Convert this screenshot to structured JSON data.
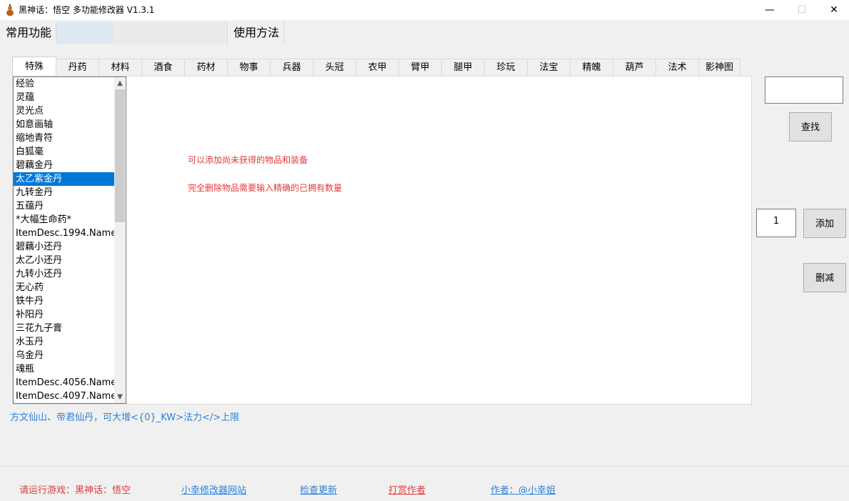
{
  "window": {
    "title": "黑神话：悟空 多功能修改器 V1.3.1",
    "minimize": "—",
    "maximize": "☐",
    "close": "✕"
  },
  "main_tabs": [
    "常用功能",
    "使用方法"
  ],
  "sub_tabs": [
    "特殊",
    "丹药",
    "材料",
    "酒食",
    "药材",
    "物事",
    "兵器",
    "头冠",
    "衣甲",
    "臂甲",
    "腿甲",
    "珍玩",
    "法宝",
    "精魄",
    "葫芦",
    "法术",
    "影神图"
  ],
  "item_list": {
    "items": [
      "经验",
      "灵蕴",
      "灵光点",
      "如意画轴",
      "缩地青符",
      "白狐毫",
      "碧藕金丹",
      "太乙紫金丹",
      "九转金丹",
      "五蕴丹",
      "*大幅生命药*",
      "ItemDesc.1994.Name",
      "碧藕小还丹",
      "太乙小还丹",
      "九转小还丹",
      "无心药",
      "铁牛丹",
      "补阳丹",
      "三花九子膏",
      "水玉丹",
      "乌金丹",
      "魂瓶",
      "ItemDesc.4056.Name",
      "ItemDesc.4097.Name"
    ],
    "selected_index": 7
  },
  "info": {
    "line1": "可以添加尚未获得的物品和装备",
    "line2": "完全删除物品需要输入精确的已拥有数量"
  },
  "controls": {
    "search_value": "",
    "search_button": "查找",
    "quantity_value": "1",
    "add_button": "添加",
    "remove_button": "删减"
  },
  "description": "方文仙山、帝君仙丹，可大增<{0}_KW>法力</>上限",
  "footer": {
    "status": "请运行游戏：黑神话：悟空",
    "website_link": "小幸修改器网站",
    "update_link": "检查更新",
    "donate_link": "打赏作者",
    "author_link": "作者：@小幸姐"
  },
  "colors": {
    "selection": "#0078d7",
    "red_text": "#e03b3b",
    "blue_text": "#2a82da"
  }
}
